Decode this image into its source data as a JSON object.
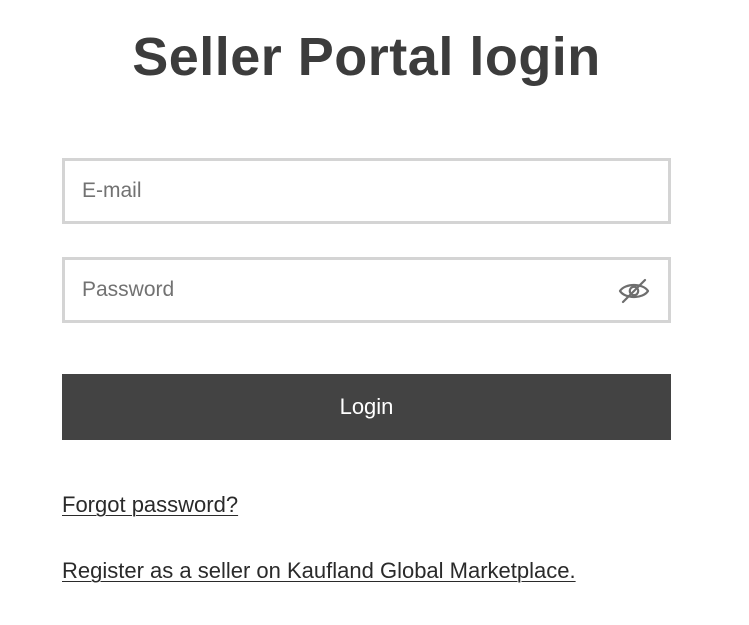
{
  "page": {
    "title": "Seller Portal login"
  },
  "form": {
    "email": {
      "placeholder": "E-mail",
      "value": ""
    },
    "password": {
      "placeholder": "Password",
      "value": "",
      "toggle_icon": "eye-slash-icon"
    },
    "login_label": "Login"
  },
  "links": {
    "forgot_password": "Forgot password?",
    "register": "Register as a seller on Kaufland Global Marketplace."
  },
  "colors": {
    "text": "#3c3c3c",
    "button_bg": "#434343",
    "button_text": "#ffffff",
    "field_border": "#d4d4d4",
    "placeholder": "#727272"
  }
}
